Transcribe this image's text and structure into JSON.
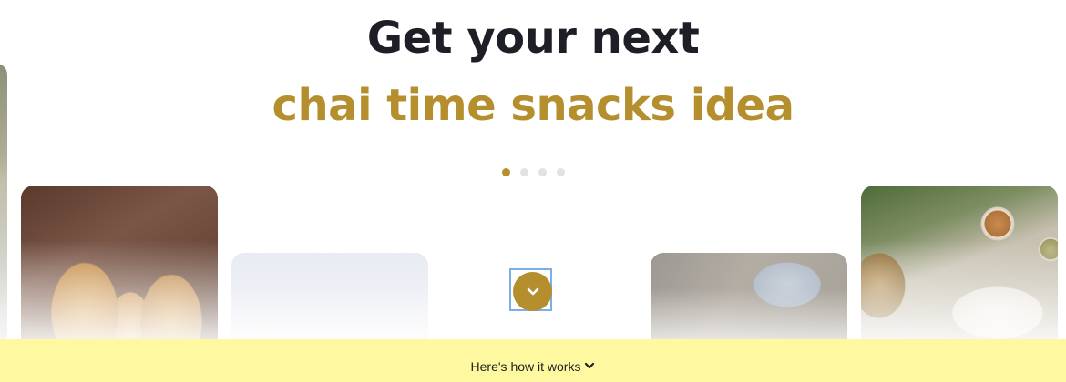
{
  "hero": {
    "headline_line1": "Get your next",
    "headline_line2": "chai time snacks idea",
    "accent_color": "#b58f2e",
    "text_color": "#1e1e26"
  },
  "carousel": {
    "slide_count": 4,
    "active_index": 0,
    "cards": [
      {
        "name": "partial-image-left"
      },
      {
        "name": "samosa-image"
      },
      {
        "name": "faded-image"
      },
      {
        "name": "cloth-basket-image"
      },
      {
        "name": "plates-and-chutney-image"
      }
    ]
  },
  "scroll_button": {
    "icon": "chevron-down-icon"
  },
  "how_it_works": {
    "label": "Here's how it works",
    "icon": "chevron-down-icon",
    "background": "#fef8a0"
  }
}
